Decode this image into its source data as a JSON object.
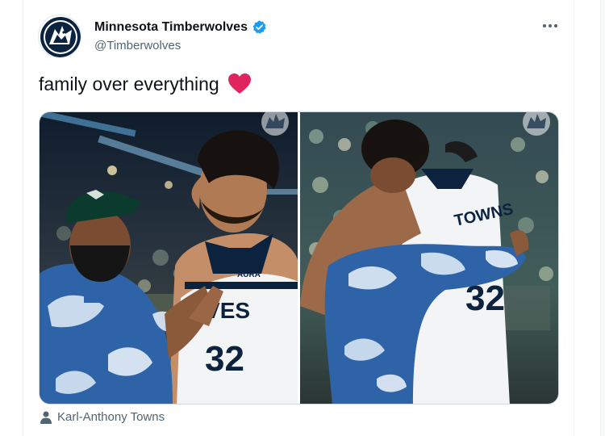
{
  "tweet": {
    "author": {
      "display_name": "Minnesota Timberwolves",
      "handle": "@Timberwolves",
      "verified": true,
      "avatar_icon": "timberwolves-logo"
    },
    "text": "family over everything",
    "emoji_icon": "red-heart",
    "media": {
      "photos": [
        {
          "jersey_text": "ÄURA",
          "jersey_front": "LVES",
          "jersey_number": "32",
          "watermark_icon": "timberwolves-logo"
        },
        {
          "jersey_back_name": "TOWNS",
          "jersey_number": "32",
          "watermark_icon": "timberwolves-logo"
        }
      ]
    },
    "tagged_user": "Karl-Anthony Towns"
  },
  "colors": {
    "text_primary": "#0f1419",
    "text_secondary": "#536471",
    "verified": "#1d9bf0",
    "heart": "#e0245e",
    "jersey_navy": "#0c2340",
    "tie_dye_blue": "#2f63a8"
  }
}
